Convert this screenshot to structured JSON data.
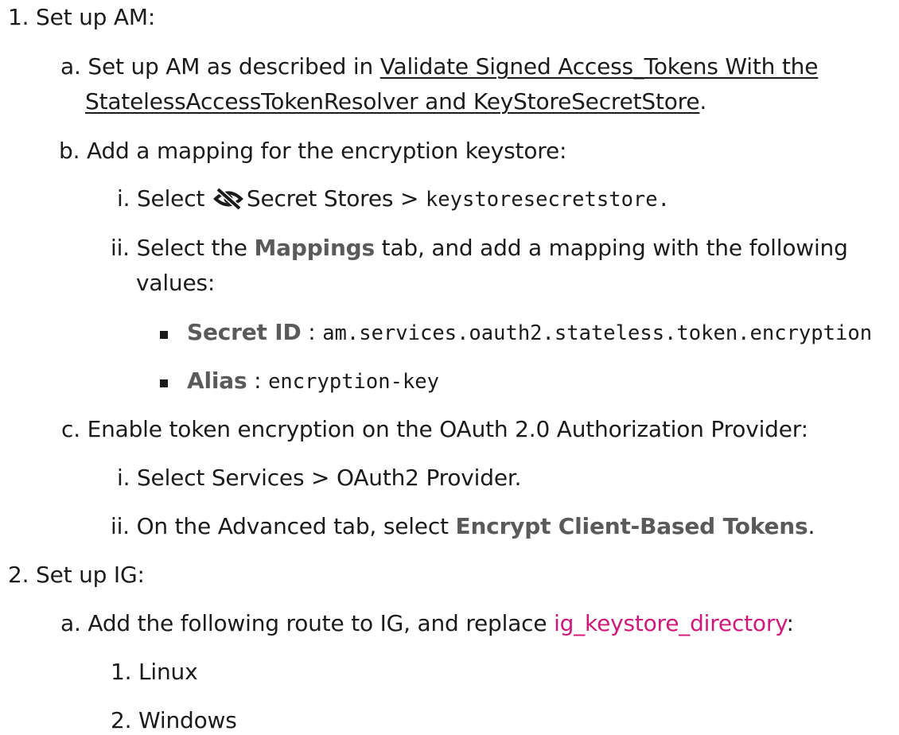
{
  "steps": [
    {
      "num": "1.",
      "text": "Set up AM:",
      "substeps": {
        "a": {
          "num": "a.",
          "prefix": "Set up AM as described in ",
          "link_line1": "Validate Signed Access_Tokens With the",
          "link_line2": "StatelessAccessTokenResolver and KeyStoreSecretStore",
          "suffix": "."
        },
        "b": {
          "num": "b.",
          "text": "Add a mapping for the encryption keystore:",
          "i": {
            "num": "i.",
            "prefix": "Select",
            "icon": "eye-slash-icon",
            "middle": "Secret Stores >",
            "code": "keystoresecretstore",
            "suffix": "."
          },
          "ii": {
            "num": "ii.",
            "prefix": "Select the ",
            "bold": "Mappings",
            "suffix": " tab, and add a mapping with the following",
            "line2": "values:",
            "bullets": [
              {
                "label": "Secret ID",
                "sep": " : ",
                "value": "am.services.oauth2.stateless.token.encryption"
              },
              {
                "label": "Alias",
                "sep": " : ",
                "value": "encryption-key"
              }
            ]
          }
        },
        "c": {
          "num": "c.",
          "text": "Enable token encryption on the OAuth 2.0 Authorization Provider:",
          "i": {
            "num": "i.",
            "text": "Select Services > OAuth2 Provider."
          },
          "ii": {
            "num": "ii.",
            "prefix": "On the Advanced tab, select ",
            "bold": "Encrypt Client-Based Tokens",
            "suffix": "."
          }
        }
      }
    },
    {
      "num": "2.",
      "text": "Set up IG:",
      "substeps": {
        "a": {
          "num": "a.",
          "prefix": "Add the following route to IG, and replace ",
          "highlight": "ig_keystore_directory",
          "suffix": ":",
          "options": [
            {
              "num": "1.",
              "label": "Linux"
            },
            {
              "num": "2.",
              "label": "Windows"
            }
          ]
        }
      }
    }
  ]
}
